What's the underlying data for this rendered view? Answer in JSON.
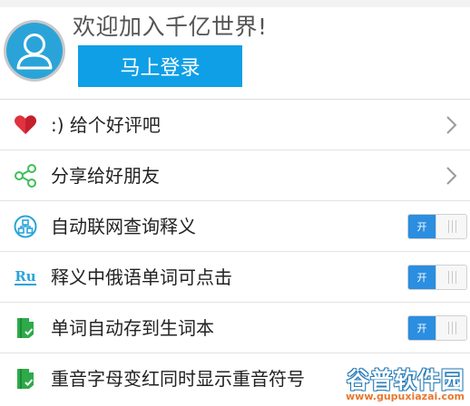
{
  "header": {
    "welcome_text": "欢迎加入千亿世界!",
    "login_label": "马上登录"
  },
  "menu": {
    "items": [
      {
        "label": ":) 给个好评吧",
        "icon": "heart-icon",
        "control": "chevron"
      },
      {
        "label": "分享给好朋友",
        "icon": "share-icon",
        "control": "chevron"
      },
      {
        "label": "自动联网查询释义",
        "icon": "network-icon",
        "control": "toggle",
        "toggle_on_label": "开",
        "enabled": true
      },
      {
        "label": "释义中俄语单词可点击",
        "icon": "russian-icon",
        "icon_text": "Ru",
        "control": "toggle",
        "toggle_on_label": "开",
        "enabled": true
      },
      {
        "label": "单词自动存到生词本",
        "icon": "wordbook-icon",
        "control": "toggle",
        "toggle_on_label": "开",
        "enabled": true
      },
      {
        "label": "重音字母变红同时显示重音符号",
        "icon": "wordbook-icon",
        "control": "none"
      }
    ]
  },
  "colors": {
    "accent_blue": "#0f9fe6",
    "toggle_blue": "#2b8ee0",
    "heart_red": "#e0323f",
    "share_green": "#3cbf5a",
    "book_green": "#2eaa4a"
  },
  "watermark": {
    "title": "谷普软件园",
    "url": "www.gupuxiazai.com"
  }
}
